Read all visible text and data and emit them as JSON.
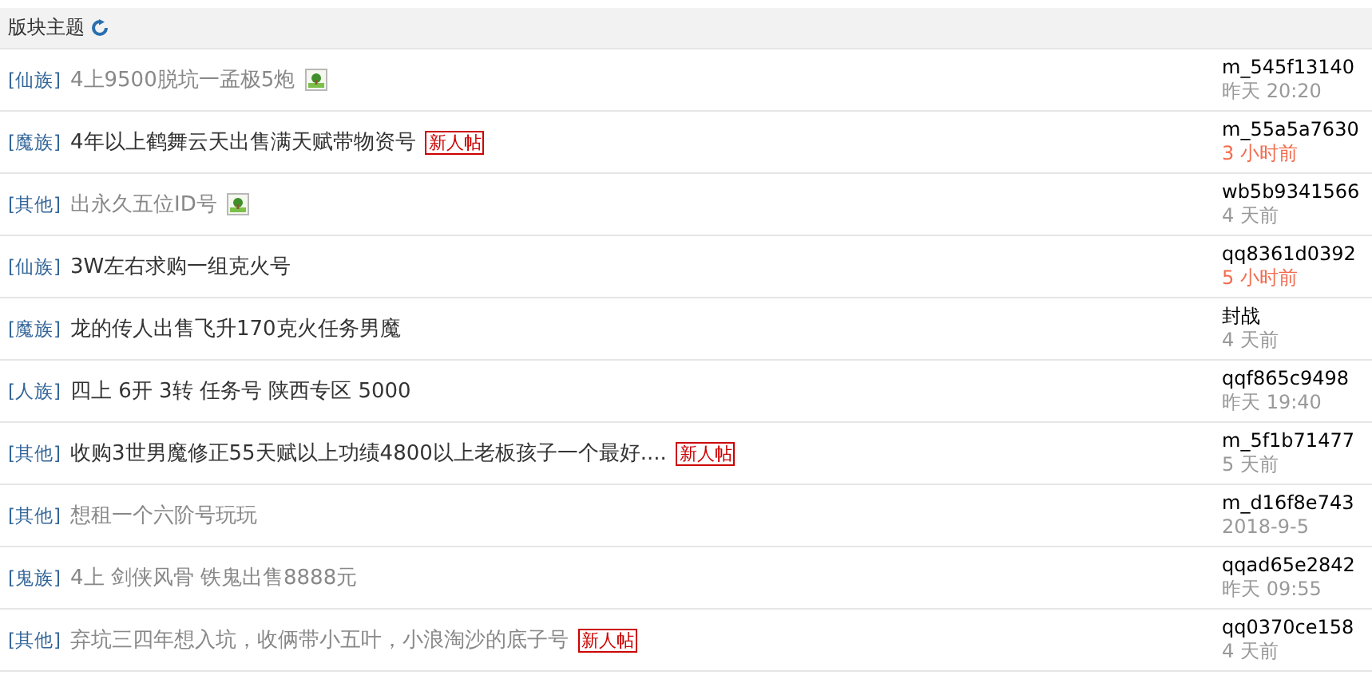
{
  "header": {
    "title": "版块主题"
  },
  "threads": [
    {
      "category": "[仙族]",
      "title": "4上9500脱坑一孟极5炮",
      "read": true,
      "attachment": true,
      "author": "m_545f13140",
      "time": "昨天 20:20",
      "recent": false
    },
    {
      "category": "[魔族]",
      "title": "4年以上鹤舞云天出售满天赋带物资号",
      "read": false,
      "badge": "新人帖",
      "author": "m_55a5a7630",
      "time": "3 小时前",
      "recent": true
    },
    {
      "category": "[其他]",
      "title": "出永久五位ID号",
      "read": true,
      "attachment": true,
      "author": "wb5b9341566",
      "time": "4 天前",
      "recent": false
    },
    {
      "category": "[仙族]",
      "title": "3W左右求购一组克火号",
      "read": false,
      "author": "qq8361d0392",
      "time": "5 小时前",
      "recent": true
    },
    {
      "category": "[魔族]",
      "title": "龙的传人出售飞升170克火任务男魔",
      "read": false,
      "author": "封战",
      "time": "4 天前",
      "recent": false
    },
    {
      "category": "[人族]",
      "title": "四上 6开 3转 任务号 陕西专区 5000",
      "read": false,
      "author": "qqf865c9498",
      "time": "昨天 19:40",
      "recent": false
    },
    {
      "category": "[其他]",
      "title": "收购3世男魔修正55天赋以上功绩4800以上老板孩子一个最好....",
      "read": false,
      "badge": "新人帖",
      "author": "m_5f1b71477",
      "time": "5 天前",
      "recent": false
    },
    {
      "category": "[其他]",
      "title": "想租一个六阶号玩玩",
      "read": true,
      "author": "m_d16f8e743",
      "time": "2018-9-5",
      "recent": false
    },
    {
      "category": "[鬼族]",
      "title": "4上 剑侠风骨 铁鬼出售8888元",
      "read": true,
      "author": "qqad65e2842",
      "time": "昨天 09:55",
      "recent": false
    },
    {
      "category": "[其他]",
      "title": "弃坑三四年想入坑，收俩带小五叶，小浪淘沙的底子号",
      "read": true,
      "badge": "新人帖",
      "author": "qq0370ce158",
      "time": "4 天前",
      "recent": false
    }
  ]
}
